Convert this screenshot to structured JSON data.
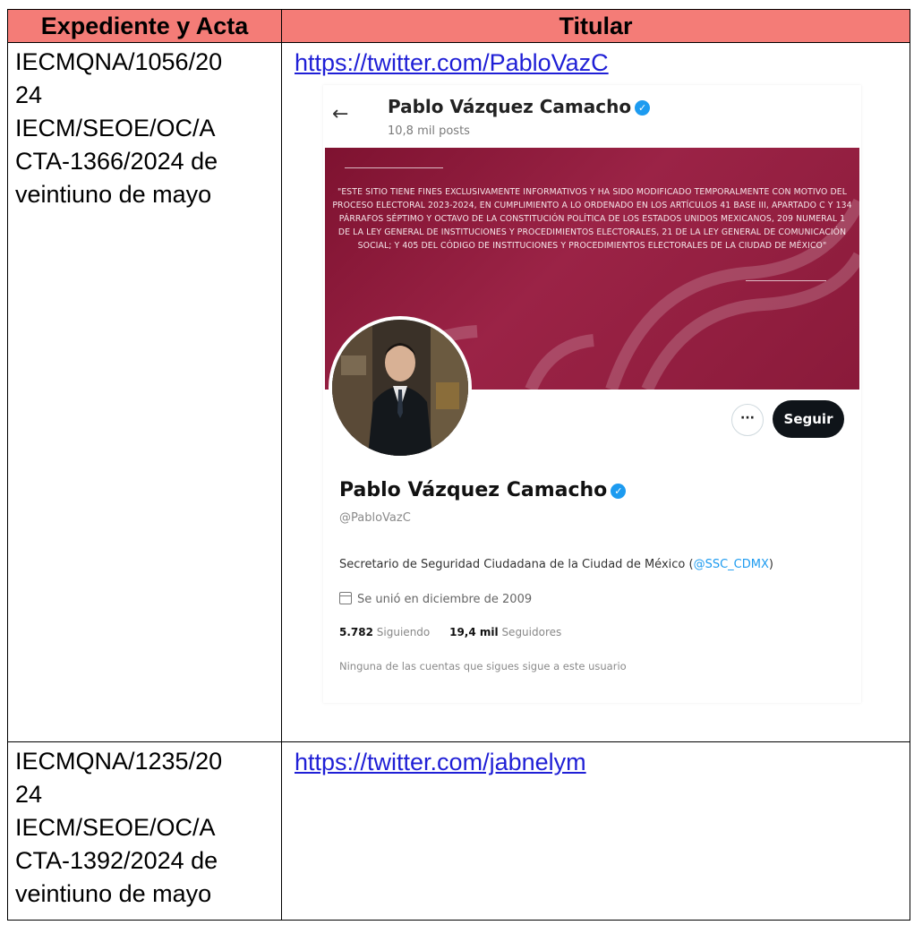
{
  "table": {
    "headers": [
      "Expediente y Acta",
      "Titular"
    ],
    "rows": [
      {
        "expediente_lines": [
          "IECMQNA/1056/20",
          "24",
          "IECM/SEOE/OC/A",
          "CTA-1366/2024  de",
          "veintiuno de mayo"
        ],
        "link": "https://twitter.com/PabloVazC"
      },
      {
        "expediente_lines": [
          "IECMQNA/1235/20",
          "24",
          "IECM/SEOE/OC/A",
          "CTA-1392/2024 de",
          "veintiuno de mayo"
        ],
        "link": "https://twitter.com/jabnelym"
      }
    ]
  },
  "twitter_profile": {
    "back_icon": "arrow-left-icon",
    "name": "Pablo Vázquez Camacho",
    "posts": "10,8 mil posts",
    "banner_text": "\"ESTE SITIO TIENE FINES EXCLUSIVAMENTE INFORMATIVOS Y HA SIDO MODIFICADO TEMPORALMENTE CON MOTIVO DEL PROCESO ELECTORAL 2023-2024, EN CUMPLIMIENTO A LO ORDENADO EN LOS ARTÍCULOS 41 BASE III, APARTADO C Y 134 PÁRRAFOS SÉPTIMO Y OCTAVO DE LA CONSTITUCIÓN POLÍTICA DE LOS ESTADOS UNIDOS MEXICANOS, 209 NUMERAL 1 DE LA LEY GENERAL DE INSTITUCIONES Y PROCEDIMIENTOS ELECTORALES, 21 DE LA LEY GENERAL DE COMUNICACIÓN SOCIAL; Y 405 DEL CÓDIGO DE INSTITUCIONES Y PROCEDIMIENTOS ELECTORALES DE LA CIUDAD DE MÉXICO\"",
    "more_label": "···",
    "follow_label": "Seguir",
    "handle": "@PabloVazC",
    "bio": "Secretario de Seguridad Ciudadana de la Ciudad de México (",
    "bio_mention": "@SSC_CDMX",
    "bio_end": ")",
    "joined": "Se unió en diciembre de 2009",
    "following_count": "5.782",
    "following_label": "Siguiendo",
    "followers_count": "19,4 mil",
    "followers_label": "Seguidores",
    "note": "Ninguna de las cuentas que sigues sigue a este usuario",
    "colors": {
      "banner": "#9b2346",
      "verified": "#1d9bf0",
      "header": "#f47c77"
    }
  }
}
